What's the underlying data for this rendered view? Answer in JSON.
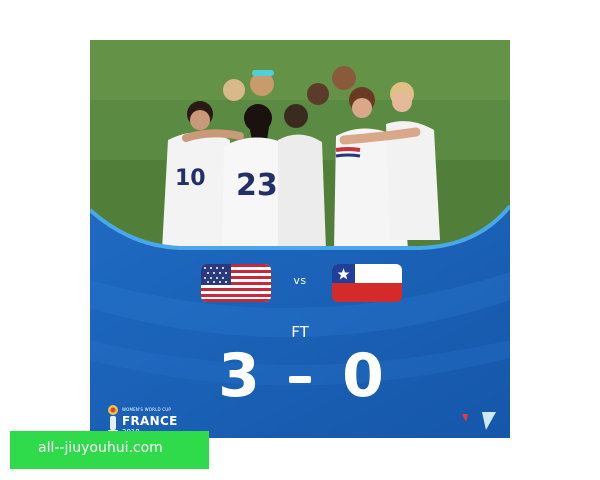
{
  "match": {
    "versus": "vs",
    "status": "FT",
    "home_score": "3",
    "away_score": "0",
    "home_team_flag": "usa-flag",
    "away_team_flag": "chile-flag"
  },
  "tournament": {
    "small": "WOMEN'S WORLD CUP",
    "name": "FRANCE",
    "year": "2019"
  },
  "photo": {
    "numbers": [
      "10",
      "23"
    ]
  },
  "watermark": {
    "text": "all--jiuyouhui.com"
  },
  "colors": {
    "panel_blue": "#1d63b8",
    "panel_blue_light": "#2f7fd6",
    "watermark_green": "#30db4b",
    "pitch_green": "#5f8f45"
  }
}
